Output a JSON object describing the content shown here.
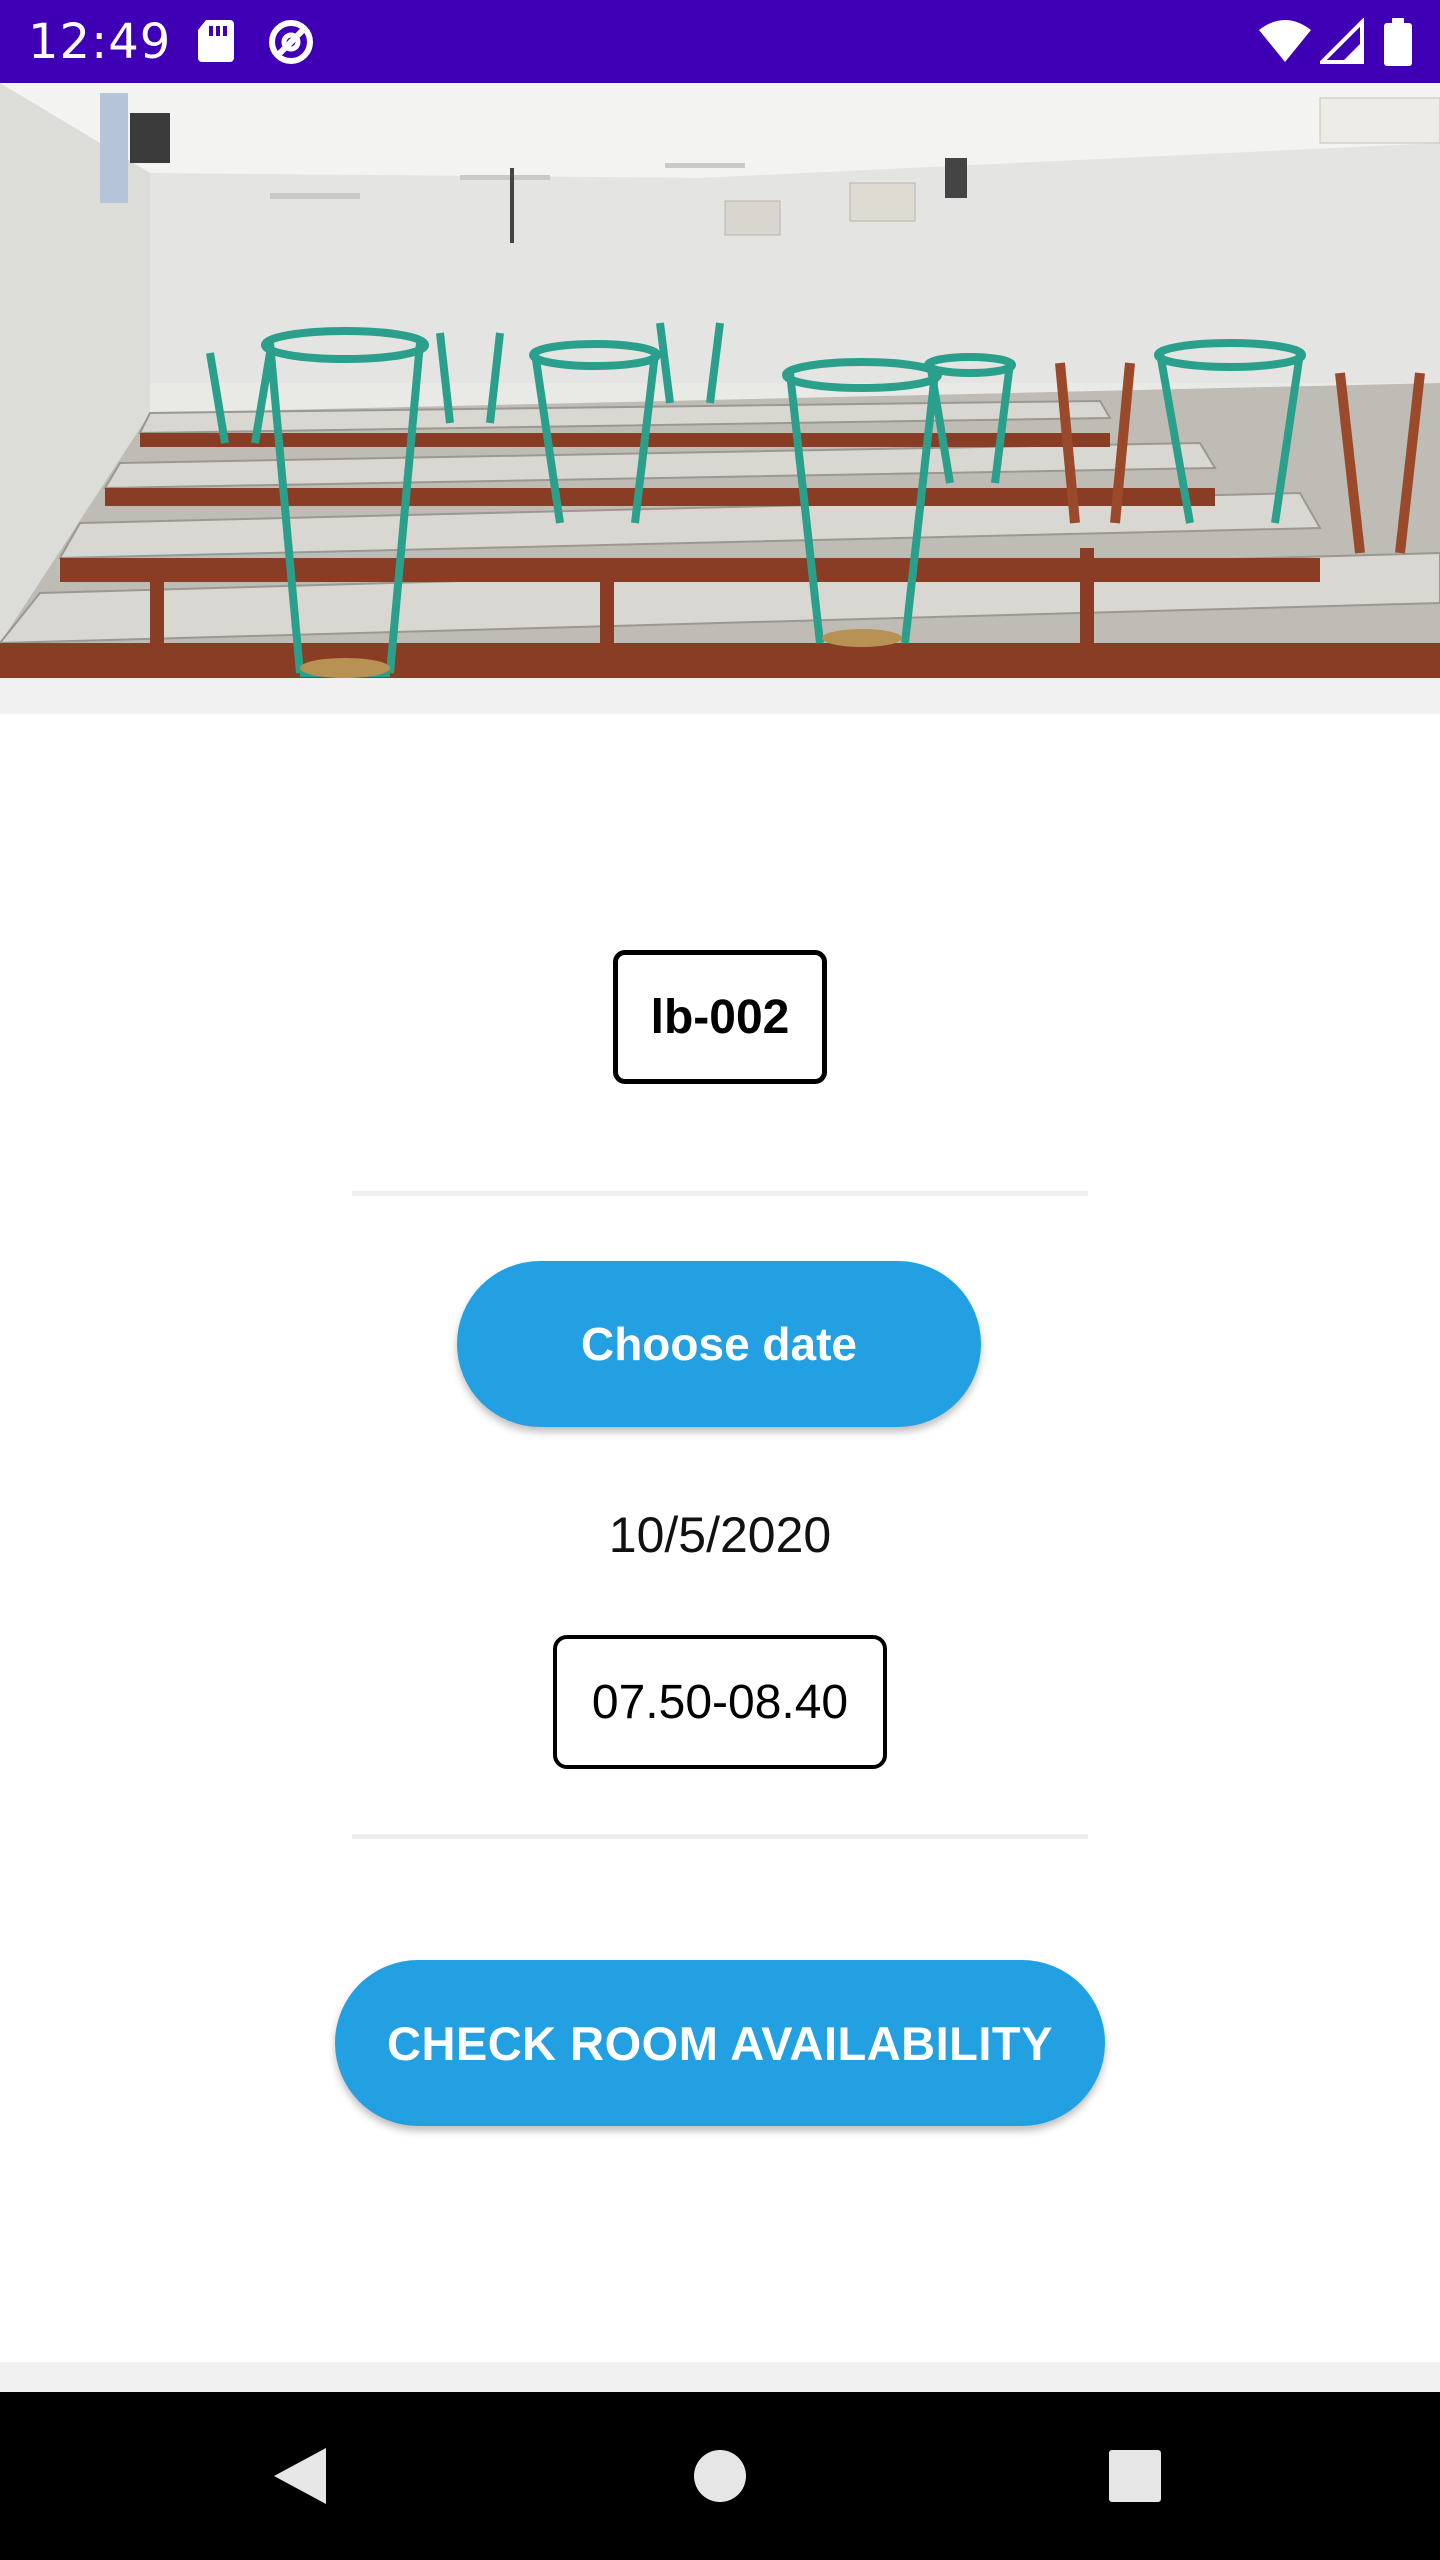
{
  "status_bar": {
    "time": "12:49",
    "icons": [
      "sd-card-icon",
      "data-saver-icon",
      "wifi-icon",
      "cell-signal-icon",
      "battery-icon"
    ],
    "background_color": "#3f00b5"
  },
  "hero": {
    "image": "classroom-photo"
  },
  "room": {
    "code": "lb-002"
  },
  "choose_date_button": {
    "label": "Choose date",
    "color": "#22a0e1"
  },
  "selected_date": "10/5/2020",
  "selected_time_slot": "07.50-08.40",
  "check_button": {
    "label": "CHECK ROOM AVAILABILITY",
    "color": "#22a0e1"
  },
  "nav_bar": {
    "icons": [
      "back-icon",
      "home-icon",
      "recents-icon"
    ]
  }
}
